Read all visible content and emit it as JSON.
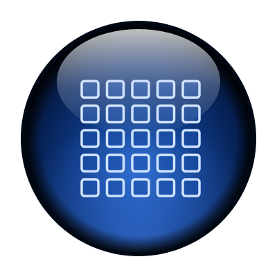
{
  "icon": {
    "name": "grid-icon",
    "kind": "glossy-orb-button",
    "grid_rows": 5,
    "grid_cols": 5,
    "colors": {
      "orb_dark": "#020a1c",
      "orb_mid": "#0b2e72",
      "orb_light": "#2f6fd0",
      "cell_stroke": "#cfe3ff",
      "cell_fill": "#1a4fa8",
      "highlight": "#ffffff"
    }
  }
}
